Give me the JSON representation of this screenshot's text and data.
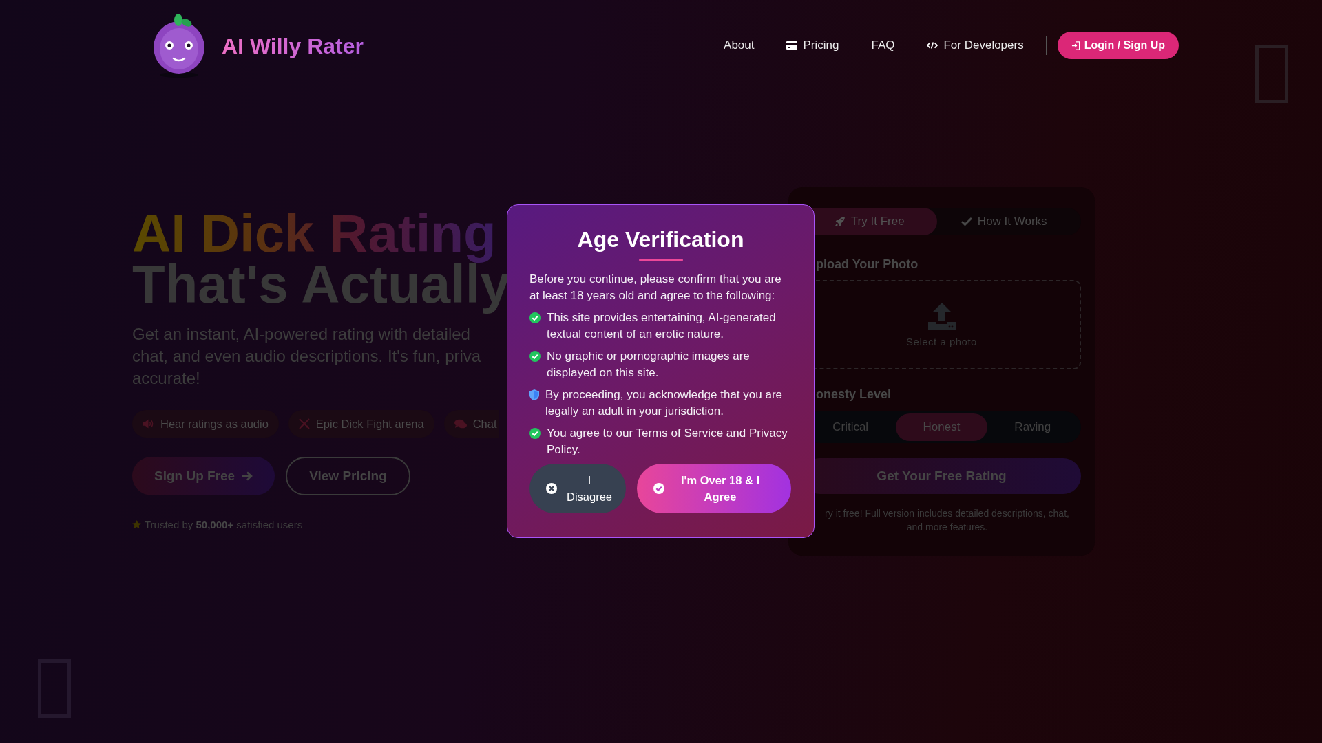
{
  "header": {
    "brand": "AI Willy Rater",
    "nav": [
      {
        "label": "About",
        "kind": "plain"
      },
      {
        "label": "Pricing",
        "kind": "card"
      },
      {
        "label": "FAQ",
        "kind": "plain"
      },
      {
        "label": "For Developers",
        "kind": "code"
      }
    ],
    "login_button": "Login / Sign Up"
  },
  "hero": {
    "title_lines": [
      "AI Dick Rating",
      "That's Actually"
    ],
    "description_lines": [
      "Get an instant, AI-powered rating with detailed",
      "chat, and even audio descriptions. It's fun, priva",
      "accurate!"
    ],
    "features": [
      {
        "label": "Hear ratings as audio",
        "kind": "speaker"
      },
      {
        "label": "Epic Dick Fight arena",
        "kind": "swords"
      },
      {
        "label": "Chat",
        "kind": "chat"
      }
    ],
    "buttons": [
      {
        "label": "Sign Up Free",
        "kind": "primary"
      },
      {
        "label": "View Pricing",
        "kind": "outline"
      }
    ],
    "trust": "Trusted by **50,000+** satisfied users"
  },
  "rater_panel": {
    "tabs": [
      {
        "label": "Try It Free",
        "kind": "rocket",
        "selected": true
      },
      {
        "label": "How It Works",
        "kind": "check",
        "selected": false
      }
    ],
    "upload_label": "pload Your Photo",
    "upload_hint": "Select a photo",
    "honesty_label": "onesty Level",
    "honesty_options": [
      {
        "label": "Critical",
        "selected": false
      },
      {
        "label": "Honest",
        "selected": true
      },
      {
        "label": "Raving",
        "selected": false
      }
    ],
    "submit_button": "Get Your Free Rating",
    "note_lines": [
      "ry it free! Full version includes detailed descriptions, chat,",
      "and more features."
    ]
  },
  "modal": {
    "title": "Age Verification",
    "intro": "Before you continue, please confirm that you are at least 18 years old and agree to the following:",
    "points": [
      {
        "text": "This site provides entertaining, AI-generated textual content of an erotic nature.",
        "kind": "check"
      },
      {
        "text": "No graphic or pornographic images are displayed on this site.",
        "kind": "check"
      },
      {
        "text": "By proceeding, you acknowledge that you are legally an adult in your jurisdiction.",
        "kind": "shield"
      },
      {
        "text": "You agree to our Terms of Service and Privacy Policy.",
        "kind": "check"
      }
    ],
    "buttons": [
      {
        "label": "I Disagree",
        "kind": "decline"
      },
      {
        "label": "I'm Over 18 & I Agree",
        "kind": "accept"
      }
    ]
  }
}
